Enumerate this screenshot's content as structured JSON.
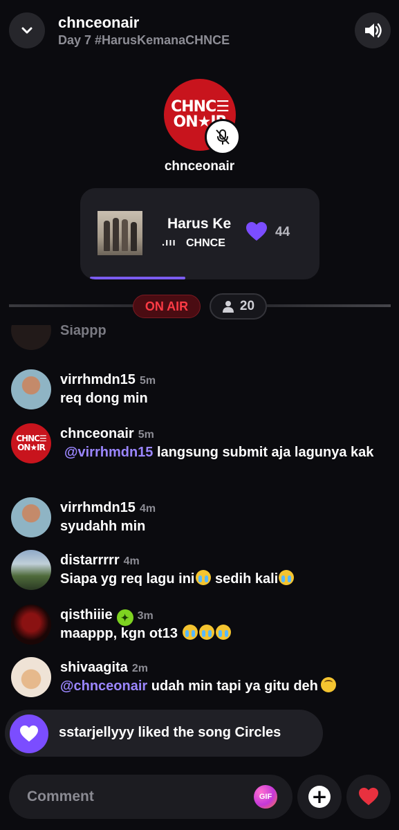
{
  "header": {
    "title": "chnceonair",
    "subtitle": "Day 7 #HarusKemanaCHNCE",
    "back_icon": "chevron-down-icon",
    "sound_icon": "speaker-icon"
  },
  "host": {
    "name": "chnceonair",
    "logo_line1": "CHNC☰",
    "logo_line2": "ON★IR",
    "mute_icon": "mic-off-icon"
  },
  "now_playing": {
    "title": "Harus Ke",
    "artist": "CHNCE",
    "eq_indicator": ".ııı",
    "likes": "44",
    "progress": 0.4
  },
  "status": {
    "on_air_label": "ON AIR",
    "listener_count": "20"
  },
  "chat": {
    "partial_message": "Siappp",
    "messages": [
      {
        "user": "virrhmdn15",
        "time": "5m",
        "text": "req dong min"
      },
      {
        "user": "chnceonair",
        "time": "5m",
        "mention": "@virrhmdn15",
        "text": " langsung submit aja lagunya kak"
      },
      {
        "user": "virrhmdn15",
        "time": "4m",
        "text": "syudahh min"
      },
      {
        "user": "distarrrrr",
        "time": "4m",
        "text_a": "Siapa yg req lagu ini",
        "text_b": " sedih kali"
      },
      {
        "user": "qisthiiie",
        "time": "3m",
        "text": "maappp, kgn ot13 "
      },
      {
        "user": "shivaagita",
        "time": "2m",
        "mention": "@chnceonair",
        "text": " udah min tapi ya gitu deh"
      }
    ]
  },
  "liked_banner": {
    "text": "sstarjellyyy liked the song Circles"
  },
  "composer": {
    "placeholder": "Comment",
    "gif_label": "GIF"
  },
  "colors": {
    "accent": "#7b4dff",
    "on_air": "#ff3b45",
    "background": "#0b0b0f"
  }
}
